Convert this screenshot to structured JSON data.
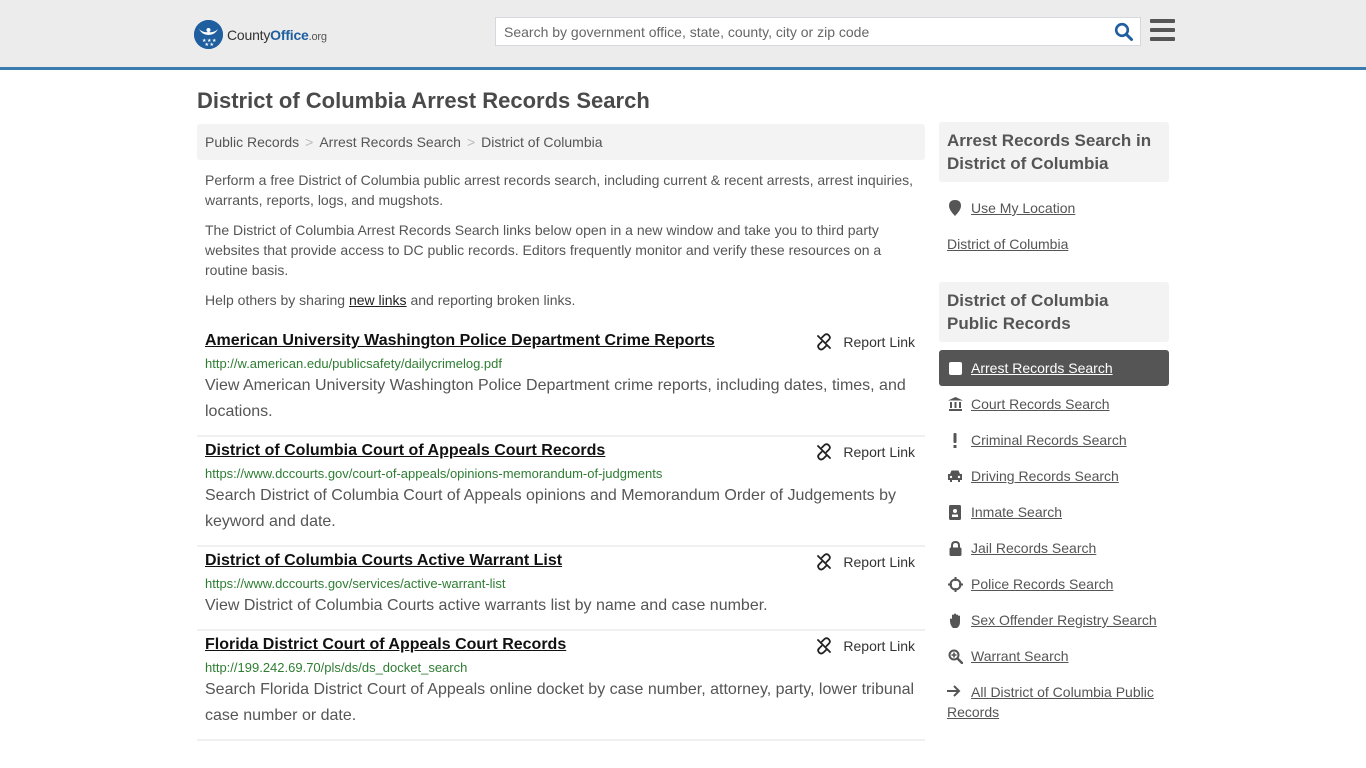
{
  "header": {
    "logo": {
      "county": "County",
      "office": "Office",
      "org": ".org"
    },
    "search_placeholder": "Search by government office, state, county, city or zip code",
    "accent_color": "#3a7bb0",
    "brand_color": "#1f5fa0"
  },
  "page_title": "District of Columbia Arrest Records Search",
  "breadcrumb": [
    "Public Records",
    "Arrest Records Search",
    "District of Columbia"
  ],
  "intro": {
    "p1": "Perform a free District of Columbia public arrest records search, including current & recent arrests, arrest inquiries, warrants, reports, logs, and mugshots.",
    "p2": "The District of Columbia Arrest Records Search links below open in a new window and take you to third party websites that provide access to DC public records. Editors frequently monitor and verify these resources on a routine basis.",
    "p3_before": "Help others by sharing ",
    "p3_link": "new links",
    "p3_after": " and reporting broken links."
  },
  "report_label": "Report Link",
  "results": [
    {
      "title": "American University Washington Police Department Crime Reports",
      "url": "http://w.american.edu/publicsafety/dailycrimelog.pdf",
      "desc": "View American University Washington Police Department crime reports, including dates, times, and locations."
    },
    {
      "title": "District of Columbia Court of Appeals Court Records",
      "url": "https://www.dccourts.gov/court-of-appeals/opinions-memorandum-of-judgments",
      "desc": "Search District of Columbia Court of Appeals opinions and Memorandum Order of Judgements by keyword and date."
    },
    {
      "title": "District of Columbia Courts Active Warrant List",
      "url": "https://www.dccourts.gov/services/active-warrant-list",
      "desc": "View District of Columbia Courts active warrants list by name and case number."
    },
    {
      "title": "Florida District Court of Appeals Court Records",
      "url": "http://199.242.69.70/pls/ds/ds_docket_search",
      "desc": "Search Florida District Court of Appeals online docket by case number, attorney, party, lower tribunal case number or date."
    }
  ],
  "sidebar": {
    "section1_title": "Arrest Records Search in District of Columbia",
    "use_location": "Use My Location",
    "location_link": "District of Columbia",
    "section2_title": "District of Columbia Public Records",
    "links": [
      {
        "label": "Arrest Records Search",
        "icon": "square-icon"
      },
      {
        "label": "Court Records Search",
        "icon": "courthouse-icon"
      },
      {
        "label": "Criminal Records Search",
        "icon": "exclamation-icon"
      },
      {
        "label": "Driving Records Search",
        "icon": "car-icon"
      },
      {
        "label": "Inmate Search",
        "icon": "id-badge-icon"
      },
      {
        "label": "Jail Records Search",
        "icon": "lock-icon"
      },
      {
        "label": "Police Records Search",
        "icon": "crosshairs-icon"
      },
      {
        "label": "Sex Offender Registry Search",
        "icon": "hand-icon"
      },
      {
        "label": "Warrant Search",
        "icon": "zoom-in-icon"
      }
    ],
    "all_link": "All District of Columbia Public Records"
  }
}
